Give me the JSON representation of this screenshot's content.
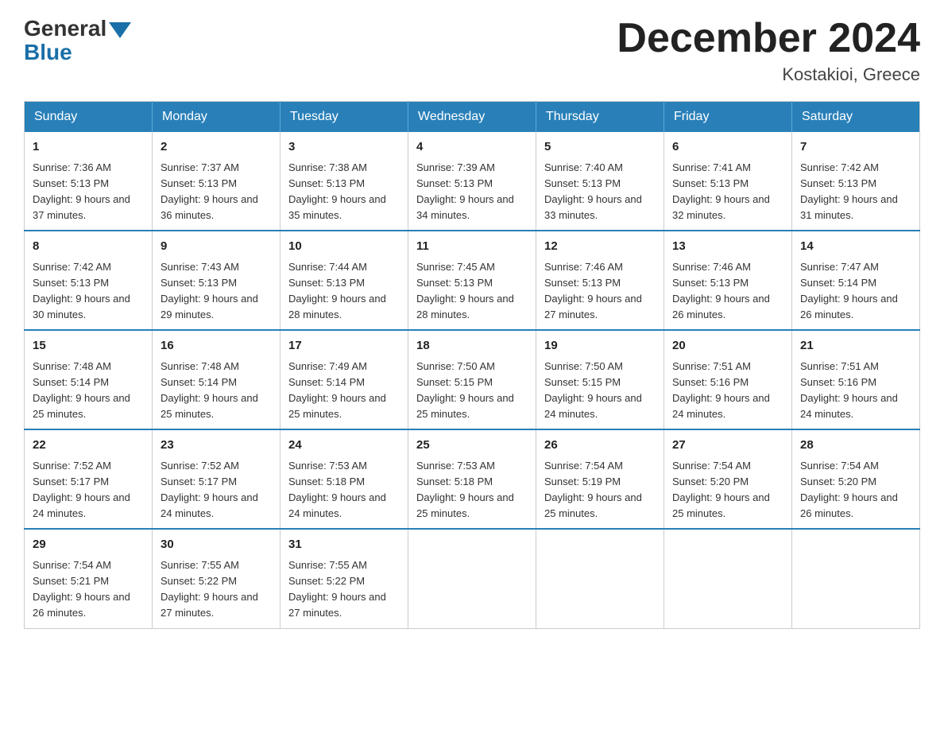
{
  "header": {
    "logo_general": "General",
    "logo_blue": "Blue",
    "month_title": "December 2024",
    "location": "Kostakioi, Greece"
  },
  "weekdays": [
    "Sunday",
    "Monday",
    "Tuesday",
    "Wednesday",
    "Thursday",
    "Friday",
    "Saturday"
  ],
  "weeks": [
    [
      {
        "day": "1",
        "sunrise": "7:36 AM",
        "sunset": "5:13 PM",
        "daylight": "9 hours and 37 minutes."
      },
      {
        "day": "2",
        "sunrise": "7:37 AM",
        "sunset": "5:13 PM",
        "daylight": "9 hours and 36 minutes."
      },
      {
        "day": "3",
        "sunrise": "7:38 AM",
        "sunset": "5:13 PM",
        "daylight": "9 hours and 35 minutes."
      },
      {
        "day": "4",
        "sunrise": "7:39 AM",
        "sunset": "5:13 PM",
        "daylight": "9 hours and 34 minutes."
      },
      {
        "day": "5",
        "sunrise": "7:40 AM",
        "sunset": "5:13 PM",
        "daylight": "9 hours and 33 minutes."
      },
      {
        "day": "6",
        "sunrise": "7:41 AM",
        "sunset": "5:13 PM",
        "daylight": "9 hours and 32 minutes."
      },
      {
        "day": "7",
        "sunrise": "7:42 AM",
        "sunset": "5:13 PM",
        "daylight": "9 hours and 31 minutes."
      }
    ],
    [
      {
        "day": "8",
        "sunrise": "7:42 AM",
        "sunset": "5:13 PM",
        "daylight": "9 hours and 30 minutes."
      },
      {
        "day": "9",
        "sunrise": "7:43 AM",
        "sunset": "5:13 PM",
        "daylight": "9 hours and 29 minutes."
      },
      {
        "day": "10",
        "sunrise": "7:44 AM",
        "sunset": "5:13 PM",
        "daylight": "9 hours and 28 minutes."
      },
      {
        "day": "11",
        "sunrise": "7:45 AM",
        "sunset": "5:13 PM",
        "daylight": "9 hours and 28 minutes."
      },
      {
        "day": "12",
        "sunrise": "7:46 AM",
        "sunset": "5:13 PM",
        "daylight": "9 hours and 27 minutes."
      },
      {
        "day": "13",
        "sunrise": "7:46 AM",
        "sunset": "5:13 PM",
        "daylight": "9 hours and 26 minutes."
      },
      {
        "day": "14",
        "sunrise": "7:47 AM",
        "sunset": "5:14 PM",
        "daylight": "9 hours and 26 minutes."
      }
    ],
    [
      {
        "day": "15",
        "sunrise": "7:48 AM",
        "sunset": "5:14 PM",
        "daylight": "9 hours and 25 minutes."
      },
      {
        "day": "16",
        "sunrise": "7:48 AM",
        "sunset": "5:14 PM",
        "daylight": "9 hours and 25 minutes."
      },
      {
        "day": "17",
        "sunrise": "7:49 AM",
        "sunset": "5:14 PM",
        "daylight": "9 hours and 25 minutes."
      },
      {
        "day": "18",
        "sunrise": "7:50 AM",
        "sunset": "5:15 PM",
        "daylight": "9 hours and 25 minutes."
      },
      {
        "day": "19",
        "sunrise": "7:50 AM",
        "sunset": "5:15 PM",
        "daylight": "9 hours and 24 minutes."
      },
      {
        "day": "20",
        "sunrise": "7:51 AM",
        "sunset": "5:16 PM",
        "daylight": "9 hours and 24 minutes."
      },
      {
        "day": "21",
        "sunrise": "7:51 AM",
        "sunset": "5:16 PM",
        "daylight": "9 hours and 24 minutes."
      }
    ],
    [
      {
        "day": "22",
        "sunrise": "7:52 AM",
        "sunset": "5:17 PM",
        "daylight": "9 hours and 24 minutes."
      },
      {
        "day": "23",
        "sunrise": "7:52 AM",
        "sunset": "5:17 PM",
        "daylight": "9 hours and 24 minutes."
      },
      {
        "day": "24",
        "sunrise": "7:53 AM",
        "sunset": "5:18 PM",
        "daylight": "9 hours and 24 minutes."
      },
      {
        "day": "25",
        "sunrise": "7:53 AM",
        "sunset": "5:18 PM",
        "daylight": "9 hours and 25 minutes."
      },
      {
        "day": "26",
        "sunrise": "7:54 AM",
        "sunset": "5:19 PM",
        "daylight": "9 hours and 25 minutes."
      },
      {
        "day": "27",
        "sunrise": "7:54 AM",
        "sunset": "5:20 PM",
        "daylight": "9 hours and 25 minutes."
      },
      {
        "day": "28",
        "sunrise": "7:54 AM",
        "sunset": "5:20 PM",
        "daylight": "9 hours and 26 minutes."
      }
    ],
    [
      {
        "day": "29",
        "sunrise": "7:54 AM",
        "sunset": "5:21 PM",
        "daylight": "9 hours and 26 minutes."
      },
      {
        "day": "30",
        "sunrise": "7:55 AM",
        "sunset": "5:22 PM",
        "daylight": "9 hours and 27 minutes."
      },
      {
        "day": "31",
        "sunrise": "7:55 AM",
        "sunset": "5:22 PM",
        "daylight": "9 hours and 27 minutes."
      },
      null,
      null,
      null,
      null
    ]
  ]
}
